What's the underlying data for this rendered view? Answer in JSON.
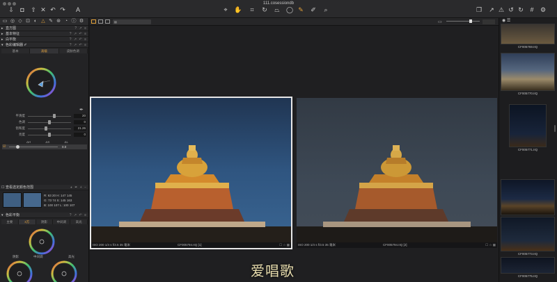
{
  "window": {
    "title": "111.cosessiondb"
  },
  "toolbar_icons": [
    "import-icon",
    "camera-icon",
    "export-icon",
    "delete-icon",
    "undo-icon",
    "redo-icon",
    "text-icon",
    "cursor-icon",
    "pan-icon",
    "crop-icon",
    "rotate-icon",
    "keystone-icon",
    "spot-icon",
    "brush-icon",
    "eraser-icon",
    "grid-icon",
    "cursor2-icon",
    "exposure-warning-icon",
    "reset-icon",
    "rotate-left-icon",
    "rotate-right-icon",
    "grid2-icon",
    "settings-icon"
  ],
  "left_panel": {
    "sections": [
      {
        "label": "直方图"
      },
      {
        "label": "基本特征"
      },
      {
        "label": "白平衡"
      },
      {
        "label": "色彩编辑器 ✐"
      }
    ],
    "color_editor_tabs": [
      "基本",
      "高级",
      "皮肤色调"
    ],
    "sliders": [
      {
        "label": "平滑度",
        "value": "20",
        "pos": 0.62
      },
      {
        "label": "色调",
        "value": "0",
        "pos": 0.5
      },
      {
        "label": "饱和度",
        "value": "21.26",
        "pos": 0.42
      },
      {
        "label": "亮度",
        "value": "0",
        "pos": 0.5
      }
    ],
    "delta_labels": [
      "ΔH",
      "ΔS",
      "ΔL"
    ],
    "delta_value": "0.0",
    "picker_section": {
      "label": "查看选定颜色范围",
      "readout": [
        {
          "r": "R: 63",
          "g": "G: 73",
          "b": "B: 100",
          "h": "20  H: 147",
          "s": "74  S: 145",
          "l": "107  L: 100",
          "v1": "145",
          "v2": "163",
          "v3": "107"
        }
      ]
    },
    "color_balance_section": {
      "label": "色彩平衡"
    },
    "color_balance_tabs": [
      "主要",
      "3方",
      "阴影",
      "中间调",
      "高光"
    ],
    "wheel_label": "中间调",
    "wheel_small_labels": [
      "阴影",
      "高光"
    ]
  },
  "viewer": {
    "zoom_value": "",
    "photos": [
      {
        "footer_left": "ISO 200   1/4 s   f/3.5   35 毫米",
        "footer_name": "CF005794.IIQ [1]"
      },
      {
        "footer_left": "ISO 200   1/4 s   f/3.5   35 毫米",
        "footer_name": "CF005794.IIQ [2]"
      }
    ]
  },
  "filmstrip": {
    "items": [
      {
        "label": "CF005769.IIQ"
      },
      {
        "label": "CF005770.IIQ"
      },
      {
        "label": "CF005771.IIQ"
      },
      {
        "label": "CF005772.IIQ"
      },
      {
        "label": "CF005773.IIQ"
      },
      {
        "label": "CF005775.IIQ"
      }
    ]
  },
  "watermark": "爱唱歌"
}
